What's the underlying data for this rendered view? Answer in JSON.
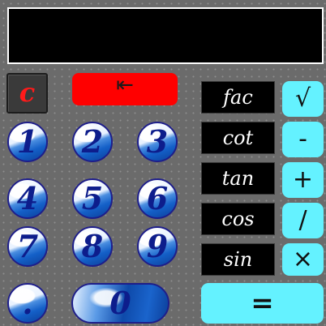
{
  "display": {
    "value": ""
  },
  "controls": {
    "clear_label": "c",
    "backspace_label": "⇤"
  },
  "digits": {
    "d1": "1",
    "d2": "2",
    "d3": "3",
    "d4": "4",
    "d5": "5",
    "d6": "6",
    "d7": "7",
    "d8": "8",
    "d9": "9",
    "dot": ".",
    "d0": "0"
  },
  "functions": {
    "fac": "fac",
    "cot": "cot",
    "tan": "tan",
    "cos": "cos",
    "sin": "sin"
  },
  "operators": {
    "sqrt": "√",
    "minus": "-",
    "plus": "+",
    "divide": "/",
    "multiply": "×",
    "equals": "="
  },
  "colors": {
    "display_bg": "#000000",
    "clear_text": "#ff1a1a",
    "backspace_bg": "#ff0000",
    "operator_bg": "#64f2ff",
    "digit_text": "#0d1d8c",
    "function_bg": "#000000"
  }
}
